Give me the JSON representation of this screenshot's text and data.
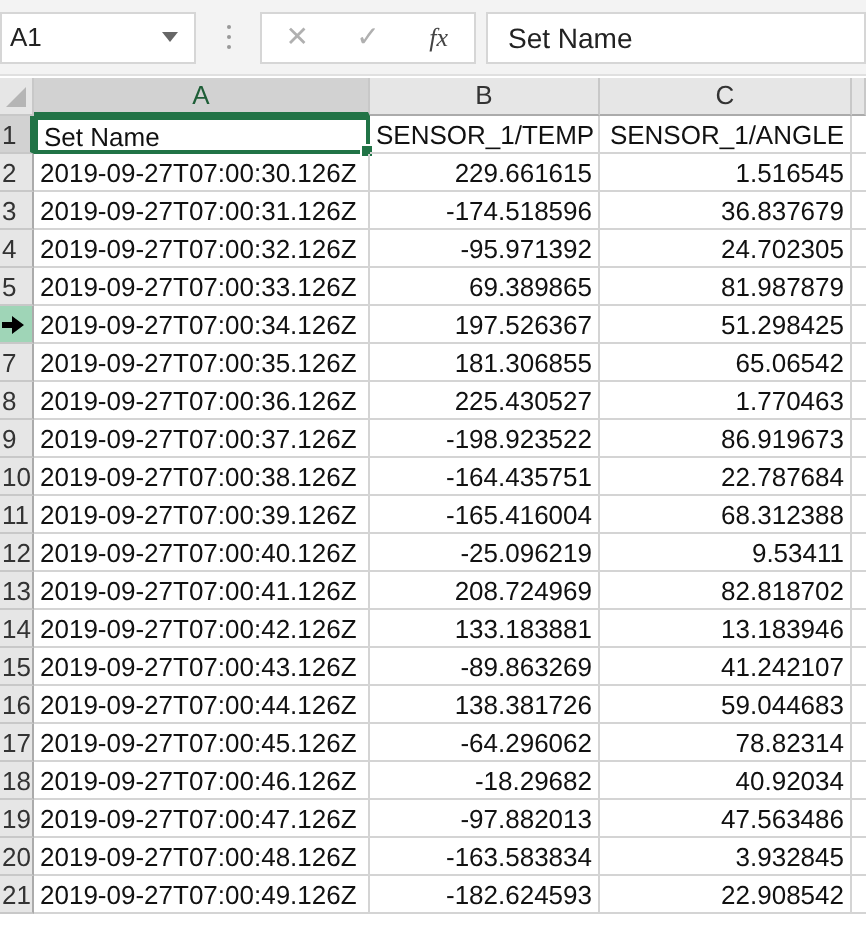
{
  "formula_bar": {
    "name_box": "A1",
    "cancel": "✕",
    "enter": "✓",
    "function": "fx",
    "value": "Set Name"
  },
  "table": {
    "columns": [
      {
        "label": "A",
        "selected": true
      },
      {
        "label": "B",
        "selected": false
      },
      {
        "label": "C",
        "selected": false
      }
    ],
    "rows": [
      {
        "header": "1",
        "selected": true,
        "hovered": false,
        "cells": [
          "Set Name",
          "SENSOR_1/TEMP",
          "SENSOR_1/ANGLE"
        ]
      },
      {
        "header": "2",
        "selected": false,
        "hovered": false,
        "cells": [
          "2019-09-27T07:00:30.126Z",
          "229.661615",
          "1.516545"
        ]
      },
      {
        "header": "3",
        "selected": false,
        "hovered": false,
        "cells": [
          "2019-09-27T07:00:31.126Z",
          "-174.518596",
          "36.837679"
        ]
      },
      {
        "header": "4",
        "selected": false,
        "hovered": false,
        "cells": [
          "2019-09-27T07:00:32.126Z",
          "-95.971392",
          "24.702305"
        ]
      },
      {
        "header": "5",
        "selected": false,
        "hovered": false,
        "cells": [
          "2019-09-27T07:00:33.126Z",
          "69.389865",
          "81.987879"
        ]
      },
      {
        "selected": false,
        "hovered": true,
        "cells": [
          "2019-09-27T07:00:34.126Z",
          "197.526367",
          "51.298425"
        ]
      },
      {
        "header": "7",
        "selected": false,
        "hovered": false,
        "cells": [
          "2019-09-27T07:00:35.126Z",
          "181.306855",
          "65.06542"
        ]
      },
      {
        "header": "8",
        "selected": false,
        "hovered": false,
        "cells": [
          "2019-09-27T07:00:36.126Z",
          "225.430527",
          "1.770463"
        ]
      },
      {
        "header": "9",
        "selected": false,
        "hovered": false,
        "cells": [
          "2019-09-27T07:00:37.126Z",
          "-198.923522",
          "86.919673"
        ]
      },
      {
        "header": "10",
        "selected": false,
        "hovered": false,
        "cells": [
          "2019-09-27T07:00:38.126Z",
          "-164.435751",
          "22.787684"
        ]
      },
      {
        "header": "11",
        "selected": false,
        "hovered": false,
        "cells": [
          "2019-09-27T07:00:39.126Z",
          "-165.416004",
          "68.312388"
        ]
      },
      {
        "header": "12",
        "selected": false,
        "hovered": false,
        "cells": [
          "2019-09-27T07:00:40.126Z",
          "-25.096219",
          "9.53411"
        ]
      },
      {
        "header": "13",
        "selected": false,
        "hovered": false,
        "cells": [
          "2019-09-27T07:00:41.126Z",
          "208.724969",
          "82.818702"
        ]
      },
      {
        "header": "14",
        "selected": false,
        "hovered": false,
        "cells": [
          "2019-09-27T07:00:42.126Z",
          "133.183881",
          "13.183946"
        ]
      },
      {
        "header": "15",
        "selected": false,
        "hovered": false,
        "cells": [
          "2019-09-27T07:00:43.126Z",
          "-89.863269",
          "41.242107"
        ]
      },
      {
        "header": "16",
        "selected": false,
        "hovered": false,
        "cells": [
          "2019-09-27T07:00:44.126Z",
          "138.381726",
          "59.044683"
        ]
      },
      {
        "header": "17",
        "selected": false,
        "hovered": false,
        "cells": [
          "2019-09-27T07:00:45.126Z",
          "-64.296062",
          "78.82314"
        ]
      },
      {
        "header": "18",
        "selected": false,
        "hovered": false,
        "cells": [
          "2019-09-27T07:00:46.126Z",
          "-18.29682",
          "40.92034"
        ]
      },
      {
        "header": "19",
        "selected": false,
        "hovered": false,
        "cells": [
          "2019-09-27T07:00:47.126Z",
          "-97.882013",
          "47.563486"
        ]
      },
      {
        "header": "20",
        "selected": false,
        "hovered": false,
        "cells": [
          "2019-09-27T07:00:48.126Z",
          "-163.583834",
          "3.932845"
        ]
      },
      {
        "header": "21",
        "selected": false,
        "hovered": false,
        "cells": [
          "2019-09-27T07:00:49.126Z",
          "-182.624593",
          "22.908542"
        ]
      }
    ]
  }
}
